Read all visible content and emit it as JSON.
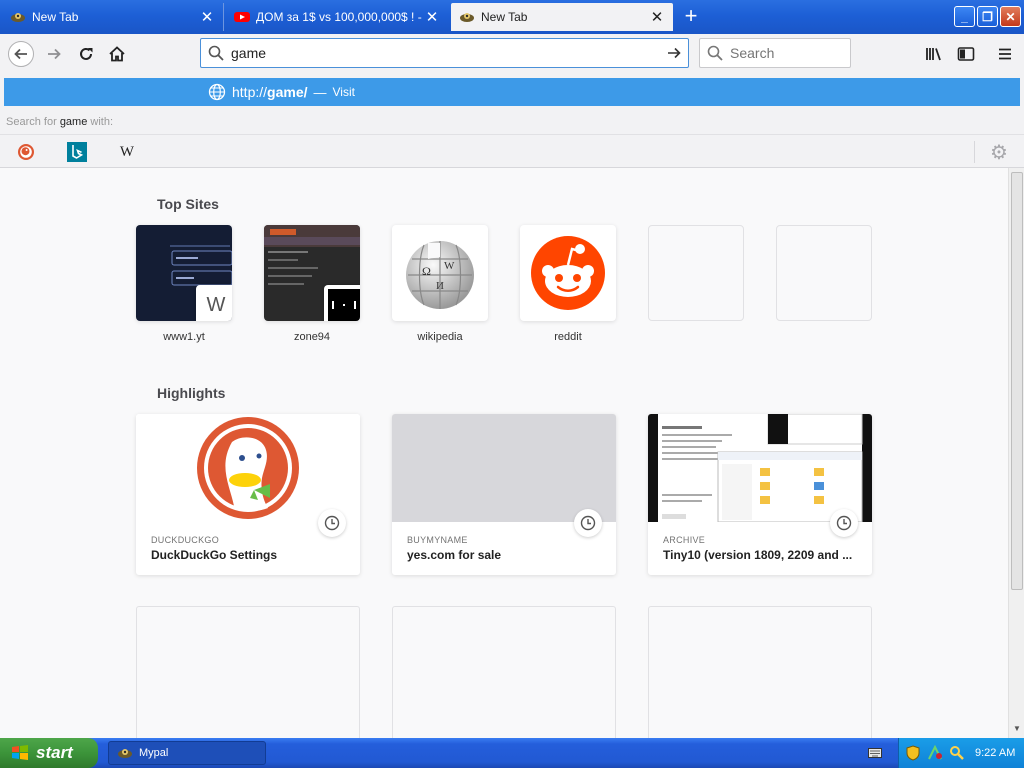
{
  "tabs": [
    {
      "title": "New Tab"
    },
    {
      "title": "ДОМ за 1$ vs 100,000,000$ ! - YouTube"
    },
    {
      "title": "New Tab"
    }
  ],
  "toolbar": {
    "url_value": "game",
    "search_placeholder": "Search"
  },
  "dropdown": {
    "suggestion_prefix": "http://",
    "suggestion_bold": "game/",
    "suggestion_dash": "—",
    "suggestion_action": "Visit",
    "search_with_prefix": "Search for ",
    "search_with_term": "game",
    "search_with_suffix": " with:",
    "engines": [
      "duckduckgo-icon",
      "bing-icon",
      "wikipedia-icon"
    ]
  },
  "topsites": {
    "heading": "Top Sites",
    "items": [
      {
        "label": "www1.yt",
        "badge": "W"
      },
      {
        "label": "zone94"
      },
      {
        "label": "wikipedia"
      },
      {
        "label": "reddit"
      }
    ]
  },
  "highlights": {
    "heading": "Highlights",
    "items": [
      {
        "context": "DUCKDUCKGO",
        "title": "DuckDuckGo Settings"
      },
      {
        "context": "BUYMYNAME",
        "title": "yes.com for sale"
      },
      {
        "context": "ARCHIVE",
        "title": "Tiny10 (version 1809, 2209 and ..."
      }
    ]
  },
  "taskbar": {
    "start_label": "start",
    "window_label": "Mypal",
    "clock": "9:22 AM"
  },
  "colors": {
    "titlebar": "#1d5fd6",
    "suggestion": "#3d9ae8",
    "reddit": "#ff4500",
    "duckduckgo": "#de5833"
  }
}
